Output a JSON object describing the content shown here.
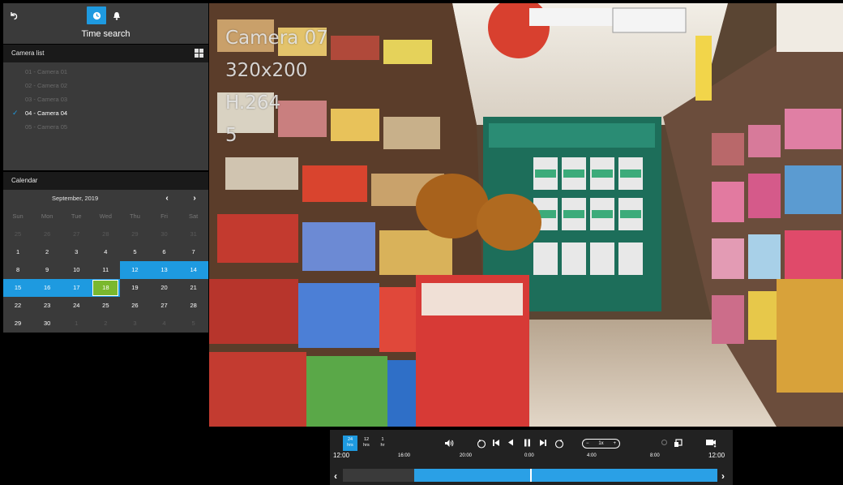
{
  "sidebar": {
    "back_icon": "undo-arrow-icon",
    "clock_icon": "clock-icon",
    "bell_icon": "bell-icon",
    "title": "Time search",
    "camera_list_header": "Camera list",
    "cameras": [
      {
        "label": "01 - Camera 01",
        "active": false
      },
      {
        "label": "02 - Camera 02",
        "active": false
      },
      {
        "label": "03 - Camera 03",
        "active": false
      },
      {
        "label": "04 - Camera 04",
        "active": true
      },
      {
        "label": "05 - Camera 05",
        "active": false
      }
    ],
    "calendar_header": "Calendar"
  },
  "calendar": {
    "month": "September, 2019",
    "prev_glyph": "‹",
    "next_glyph": "›",
    "weekdays": [
      "Sun",
      "Mon",
      "Tue",
      "Wed",
      "Thu",
      "Fri",
      "Sat"
    ],
    "weeks": [
      [
        {
          "d": "25",
          "s": "dim"
        },
        {
          "d": "26",
          "s": "dim"
        },
        {
          "d": "27",
          "s": "dim"
        },
        {
          "d": "28",
          "s": "dim"
        },
        {
          "d": "29",
          "s": "dim"
        },
        {
          "d": "30",
          "s": "dim"
        },
        {
          "d": "31",
          "s": "dim"
        }
      ],
      [
        {
          "d": "1",
          "s": ""
        },
        {
          "d": "2",
          "s": ""
        },
        {
          "d": "3",
          "s": ""
        },
        {
          "d": "4",
          "s": ""
        },
        {
          "d": "5",
          "s": ""
        },
        {
          "d": "6",
          "s": ""
        },
        {
          "d": "7",
          "s": ""
        }
      ],
      [
        {
          "d": "8",
          "s": ""
        },
        {
          "d": "9",
          "s": ""
        },
        {
          "d": "10",
          "s": ""
        },
        {
          "d": "11",
          "s": ""
        },
        {
          "d": "12",
          "s": "sel"
        },
        {
          "d": "13",
          "s": "sel"
        },
        {
          "d": "14",
          "s": "sel"
        }
      ],
      [
        {
          "d": "15",
          "s": "sel"
        },
        {
          "d": "16",
          "s": "sel"
        },
        {
          "d": "17",
          "s": "sel"
        },
        {
          "d": "18",
          "s": "today"
        },
        {
          "d": "19",
          "s": ""
        },
        {
          "d": "20",
          "s": ""
        },
        {
          "d": "21",
          "s": ""
        }
      ],
      [
        {
          "d": "22",
          "s": ""
        },
        {
          "d": "23",
          "s": ""
        },
        {
          "d": "24",
          "s": ""
        },
        {
          "d": "25",
          "s": ""
        },
        {
          "d": "26",
          "s": ""
        },
        {
          "d": "27",
          "s": ""
        },
        {
          "d": "28",
          "s": ""
        }
      ],
      [
        {
          "d": "29",
          "s": ""
        },
        {
          "d": "30",
          "s": ""
        },
        {
          "d": "1",
          "s": "dim"
        },
        {
          "d": "2",
          "s": "dim"
        },
        {
          "d": "3",
          "s": "dim"
        },
        {
          "d": "4",
          "s": "dim"
        },
        {
          "d": "5",
          "s": "dim"
        }
      ]
    ]
  },
  "video": {
    "osd_camera": "Camera 07",
    "osd_resolution": "320x200",
    "osd_codec": "H.264",
    "osd_fps": "5"
  },
  "playback": {
    "ranges": [
      {
        "top": "24",
        "bottom": "hrs",
        "on": true
      },
      {
        "top": "12",
        "bottom": "hrs",
        "on": false
      },
      {
        "top": "1",
        "bottom": "hr",
        "on": false
      }
    ],
    "speed": "1x",
    "speed_minus": "−",
    "speed_plus": "+",
    "time_labels": [
      "12:00",
      "16:00",
      "20:00",
      "0:00",
      "4:00",
      "8:00",
      "12:00"
    ],
    "fill_start": 0.19,
    "fill_end": 1.0,
    "cursor": 0.5,
    "left_arrow": "‹",
    "right_arrow": "›"
  },
  "colors": {
    "accent": "#1e9ae0",
    "today": "#7ab82e",
    "panel": "#3a3a3a"
  }
}
